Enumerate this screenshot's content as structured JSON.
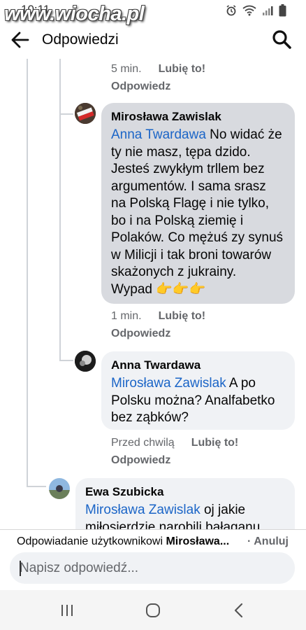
{
  "status_bar": {
    "time": "10:11",
    "watermark": "www.wiocha.pl"
  },
  "header": {
    "title": "Odpowiedzi"
  },
  "comments": [
    {
      "time": "5 min.",
      "like": "Lubię to!",
      "reply": "Odpowiedz"
    },
    {
      "author": "Mirosława Zawislak",
      "mention": "Anna Twardawa",
      "lines": [
        " No widać że",
        "ty nie masz, tępa dzido.",
        "Jesteś zwykłym trllem bez",
        "argumentów. I sama srasz",
        "na Polską Flagę i nie tylko,",
        "bo i na Polską ziemię i",
        "Polaków. Co mężuś zy synuś",
        "w Milicji i tak broni towarów",
        "skażonych z jukrainy.",
        "Wypad 👉👉👉"
      ],
      "time": "1 min.",
      "like": "Lubię to!",
      "reply": "Odpowiedz"
    },
    {
      "author": "Anna Twardawa",
      "mention": "Mirosława Zawislak",
      "lines": [
        " A po",
        "Polsku można? Analfabetko",
        "bez ząbków?"
      ],
      "time": "Przed chwilą",
      "like": "Lubię to!",
      "reply": "Odpowiedz"
    },
    {
      "author": "Ewa Szubicka",
      "mention": "Mirosława Zawislak",
      "lines": [
        " oj jakie",
        "miłosierdzie narobili bałaganu"
      ]
    }
  ],
  "reply_banner": {
    "prefix": "Odpowiadanie użytkownikowi ",
    "name": "Mirosława...",
    "separator": "· ",
    "cancel": "Anuluj"
  },
  "composer": {
    "placeholder": "Napisz odpowiedź..."
  },
  "colors": {
    "mention": "#1b65c7",
    "bubble_selected": "#d8dadf",
    "bubble": "#f0f2f5",
    "meta": "#65676b"
  },
  "icons": [
    "back-arrow-icon",
    "search-icon",
    "alarm-icon",
    "wifi-icon",
    "signal-icon",
    "battery-icon",
    "recents-icon",
    "home-icon",
    "back-nav-icon"
  ]
}
